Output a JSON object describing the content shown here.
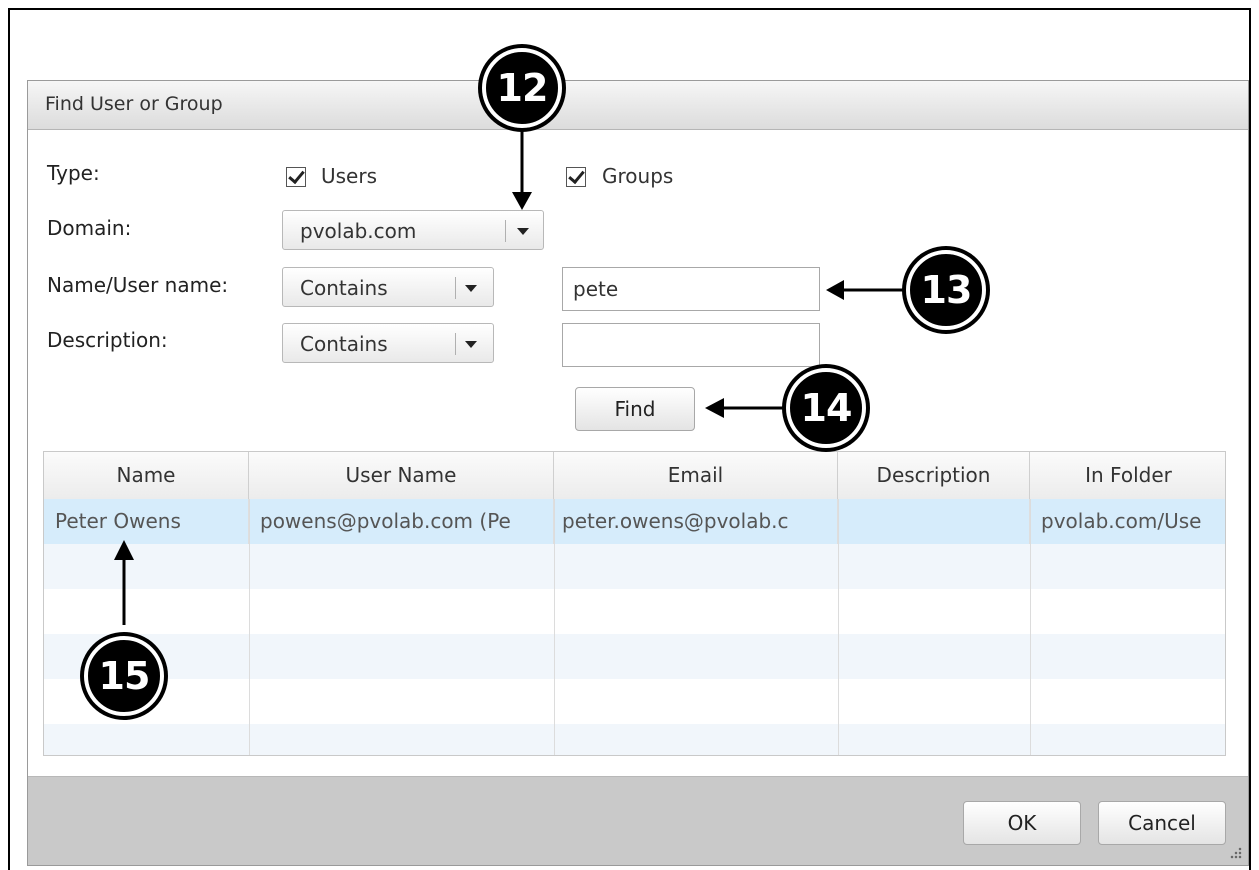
{
  "dialog": {
    "title": "Find User or Group"
  },
  "form": {
    "type_label": "Type:",
    "users_label": "Users",
    "users_checked": true,
    "groups_label": "Groups",
    "groups_checked": true,
    "domain_label": "Domain:",
    "domain_value": "pvolab.com",
    "name_label": "Name/User name:",
    "name_match": "Contains",
    "name_value": "pete",
    "description_label": "Description:",
    "description_match": "Contains",
    "description_value": "",
    "find_label": "Find"
  },
  "results": {
    "columns": [
      "Name",
      "User Name",
      "Email",
      "Description",
      "In Folder"
    ],
    "rows": [
      {
        "name": "Peter Owens",
        "user_name": "powens@pvolab.com (Pe",
        "email": "peter.owens@pvolab.c",
        "description": "",
        "folder": "pvolab.com/Use"
      }
    ]
  },
  "footer": {
    "ok_label": "OK",
    "cancel_label": "Cancel"
  },
  "callouts": {
    "c12": "12",
    "c13": "13",
    "c14": "14",
    "c15": "15"
  },
  "colors": {
    "selected_row": "#d6ecfb",
    "footer_bg": "#c9c9c9"
  }
}
